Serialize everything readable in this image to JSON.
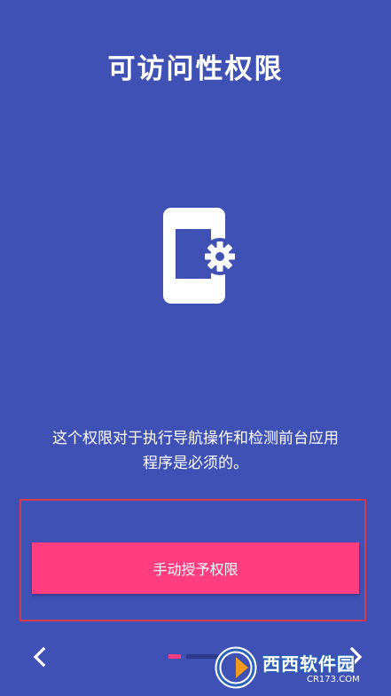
{
  "screen": {
    "title": "可访问性权限",
    "description_line1": "这个权限对于执行导航操作和检测前台应用",
    "description_line2": "程序是必须的。",
    "illustration_icon": "phone-settings-icon"
  },
  "actions": {
    "grant_button_label": "手动授予权限"
  },
  "navigation": {
    "back_icon": "chevron-left-icon",
    "next_icon": "chevron-right-icon",
    "page_count": 2,
    "active_page": 1
  },
  "watermark": {
    "text": "西西软件园",
    "sub": "CR173.COM"
  },
  "colors": {
    "background": "#3f51b5",
    "accent": "#ff3d7f",
    "highlight_border": "#d23a4f",
    "text": "#ffffff"
  }
}
